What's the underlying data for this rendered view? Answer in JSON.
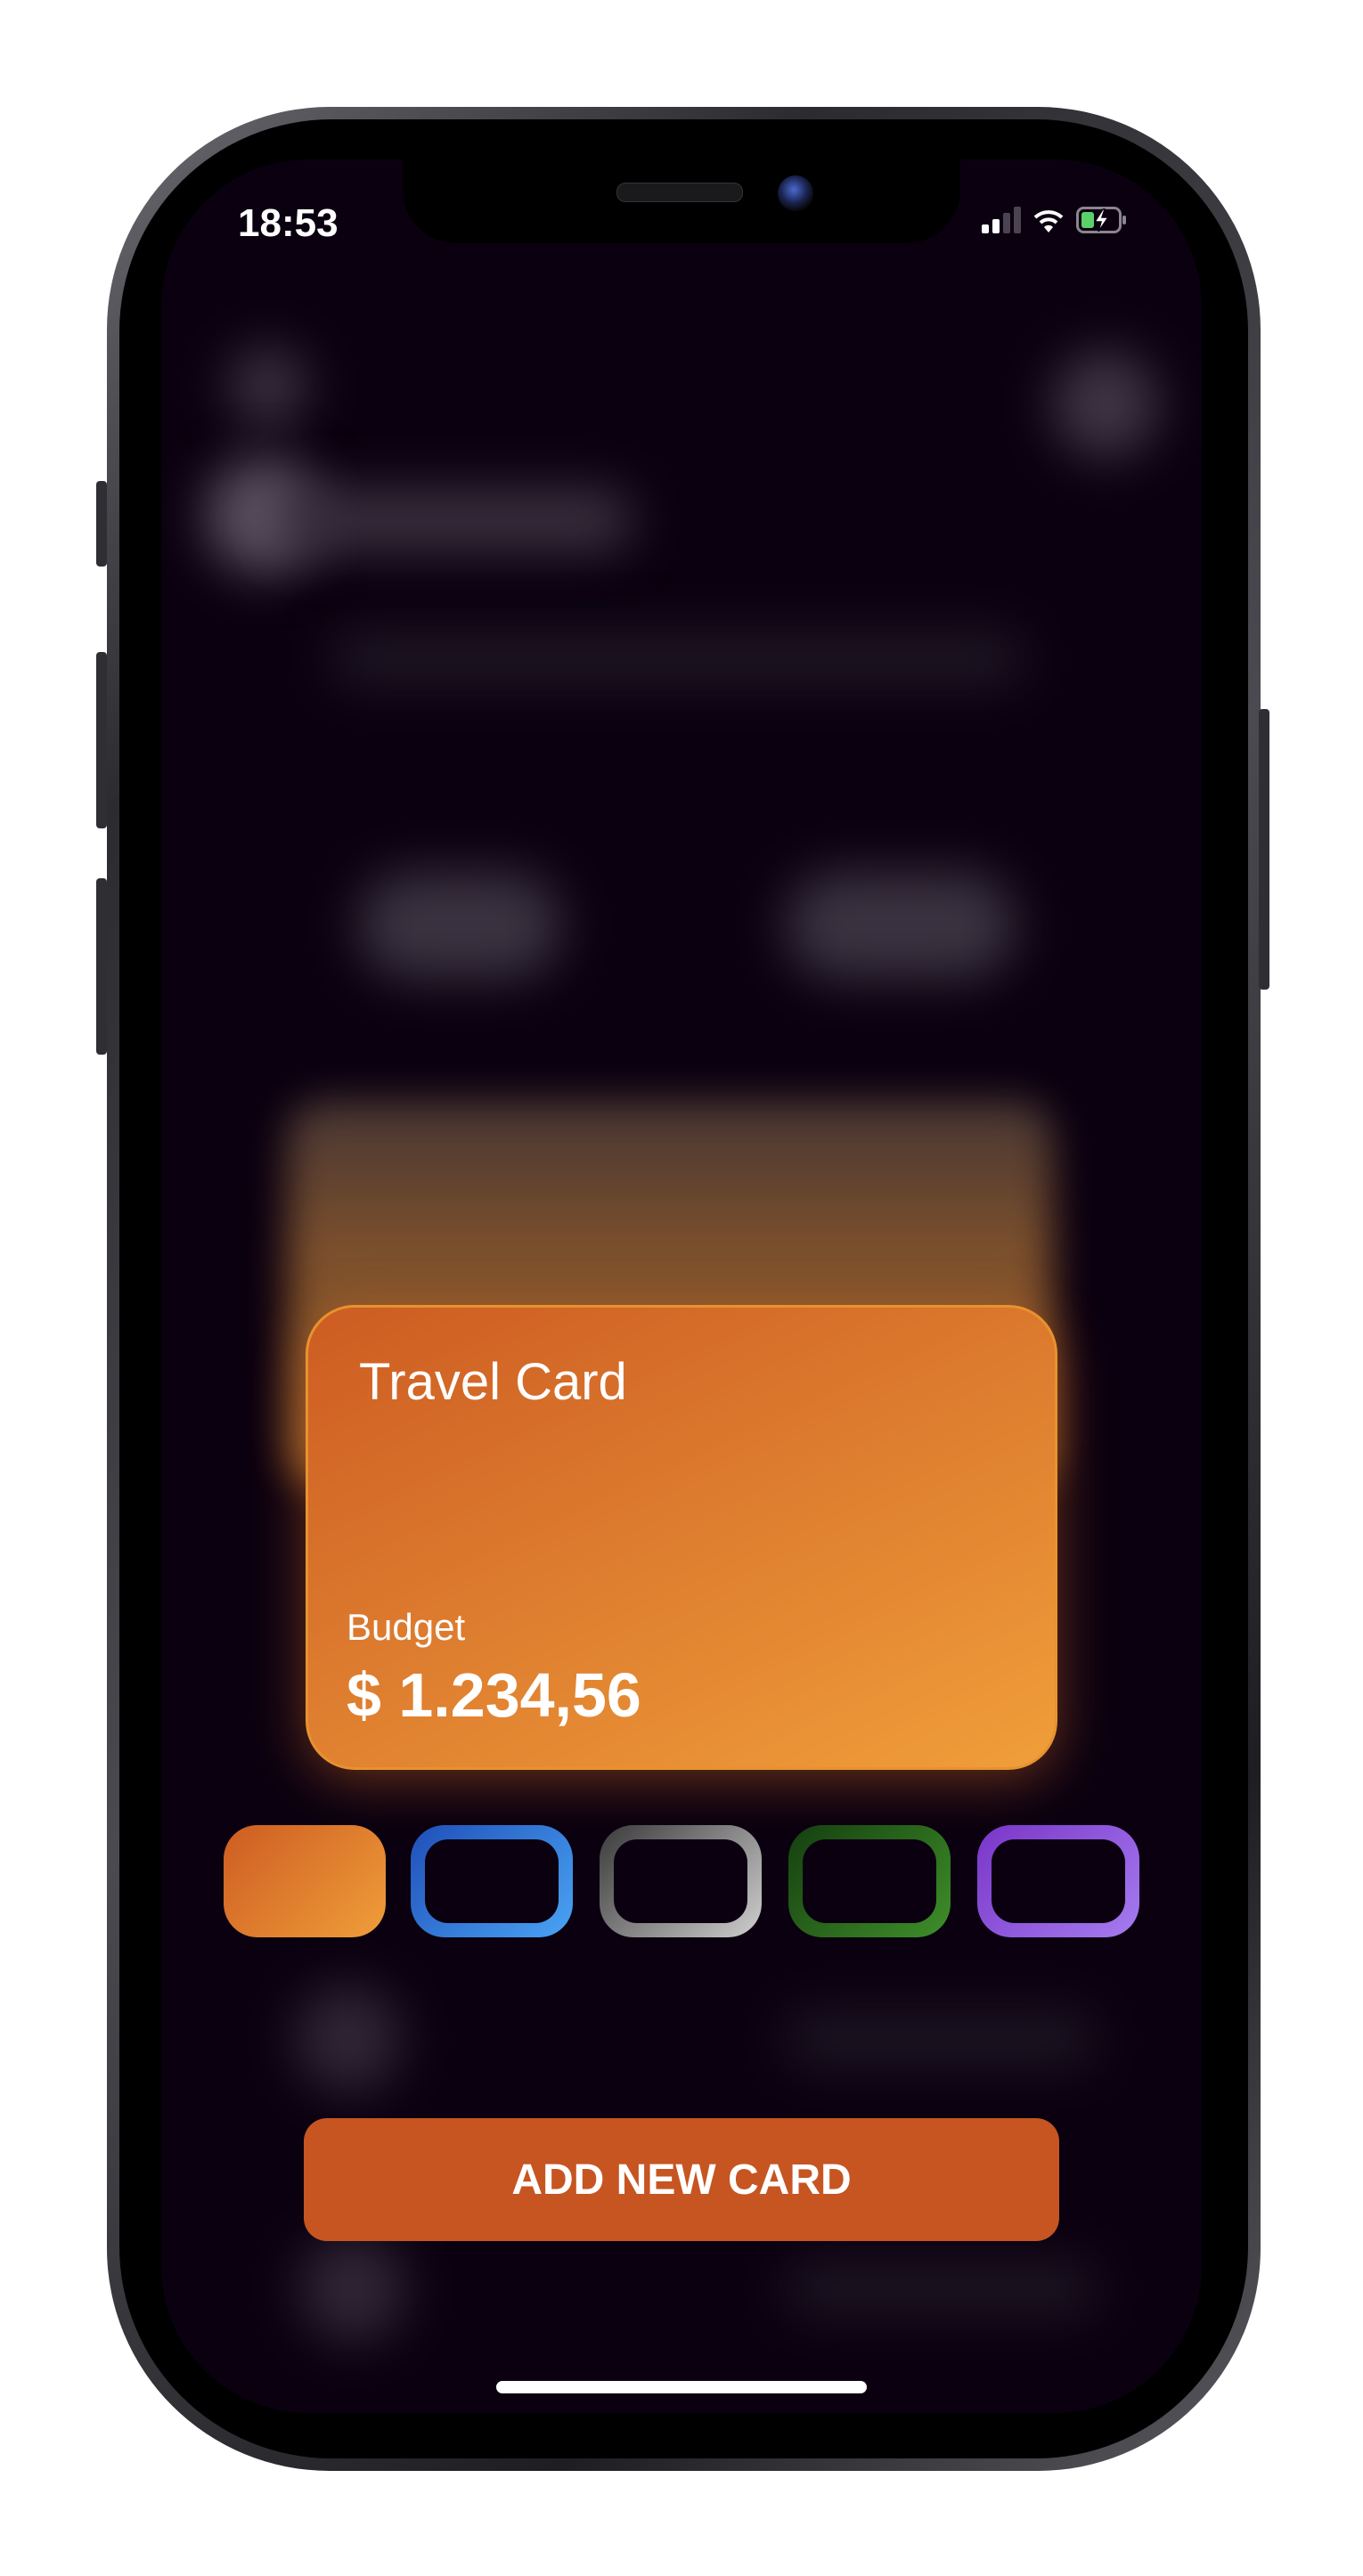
{
  "status_bar": {
    "time": "18:53",
    "signal_icon": "cellular-signal-icon",
    "wifi_icon": "wifi-icon",
    "battery_icon": "battery-charging-icon"
  },
  "card": {
    "title": "Travel Card",
    "budget_label": "Budget",
    "budget_value": "$ 1.234,56",
    "gradient": [
      "#cd5c22",
      "#f09e3a"
    ]
  },
  "color_options": [
    {
      "name": "orange",
      "colors": [
        "#cd5c22",
        "#f09e3a"
      ],
      "selected": true
    },
    {
      "name": "blue",
      "colors": [
        "#1f4fb8",
        "#4aa4f5"
      ],
      "selected": false
    },
    {
      "name": "gray",
      "colors": [
        "#3a3a3a",
        "#cfcfcf"
      ],
      "selected": false
    },
    {
      "name": "green",
      "colors": [
        "#153f10",
        "#3f8f2a"
      ],
      "selected": false
    },
    {
      "name": "purple",
      "colors": [
        "#7a35c8",
        "#a57cf0"
      ],
      "selected": false
    }
  ],
  "add_button": {
    "label": "ADD NEW CARD",
    "color": "#c65522"
  }
}
